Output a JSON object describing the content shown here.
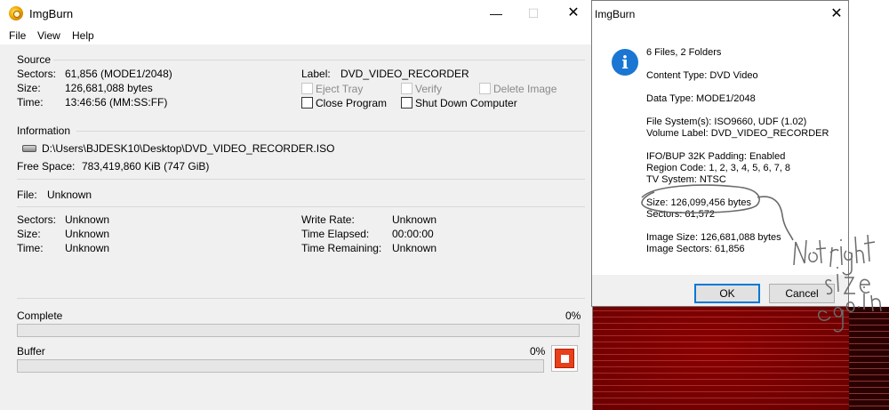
{
  "main_window": {
    "title": "ImgBurn",
    "controls": {
      "minimize": "—",
      "maximize": "☐",
      "close": "✕"
    },
    "menu": [
      "File",
      "View",
      "Help"
    ],
    "source": {
      "heading": "Source",
      "sectors_label": "Sectors:",
      "sectors_value": "61,856 (MODE1/2048)",
      "size_label": "Size:",
      "size_value": "126,681,088 bytes",
      "time_label": "Time:",
      "time_value": "13:46:56 (MM:SS:FF)",
      "label_label": "Label:",
      "label_value": "DVD_VIDEO_RECORDER"
    },
    "options": [
      {
        "label": "Eject Tray",
        "checked": false,
        "enabled": false
      },
      {
        "label": "Verify",
        "checked": false,
        "enabled": false
      },
      {
        "label": "Delete Image",
        "checked": false,
        "enabled": false
      },
      {
        "label": "Close Program",
        "checked": false,
        "enabled": true
      },
      {
        "label": "Shut Down Computer",
        "checked": false,
        "enabled": true
      }
    ],
    "information": {
      "heading": "Information",
      "path": "D:\\Users\\BJDESK10\\Desktop\\DVD_VIDEO_RECORDER.ISO",
      "free_space_label": "Free Space:",
      "free_space_value": "783,419,860 KiB  (747 GiB)",
      "file_label": "File:",
      "file_value": "Unknown",
      "sectors_label": "Sectors:",
      "sectors_value": "Unknown",
      "size_label": "Size:",
      "size_value": "Unknown",
      "time_label": "Time:",
      "time_value": "Unknown",
      "write_rate_label": "Write Rate:",
      "write_rate_value": "Unknown",
      "time_elapsed_label": "Time Elapsed:",
      "time_elapsed_value": "00:00:00",
      "time_remaining_label": "Time Remaining:",
      "time_remaining_value": "Unknown"
    },
    "complete": {
      "label": "Complete",
      "percent_text": "0%",
      "progress": 0
    },
    "buffer": {
      "label": "Buffer",
      "percent_text": "0%",
      "progress": 0
    }
  },
  "dialog": {
    "title": "ImgBurn",
    "close": "✕",
    "icon": "info-icon",
    "lines": [
      "6 Files, 2 Folders",
      "Content Type: DVD Video",
      "Data Type: MODE1/2048",
      "File System(s): ISO9660, UDF (1.02)",
      "Volume Label: DVD_VIDEO_RECORDER",
      "IFO/BUP 32K Padding: Enabled",
      "Region Code: 1, 2, 3, 4, 5, 6, 7, 8",
      "TV System: NTSC",
      "Size: 126,099,456 bytes",
      "Sectors: 61,572",
      "Image Size: 126,681,088 bytes",
      "Image Sectors: 61,856"
    ],
    "ok_label": "OK",
    "cancel_label": "Cancel"
  },
  "annotation": "Not right size cgo.in",
  "colors": {
    "accent": "#0078d7",
    "info_icon": "#1a76d2",
    "stop_button": "#e8401a"
  }
}
